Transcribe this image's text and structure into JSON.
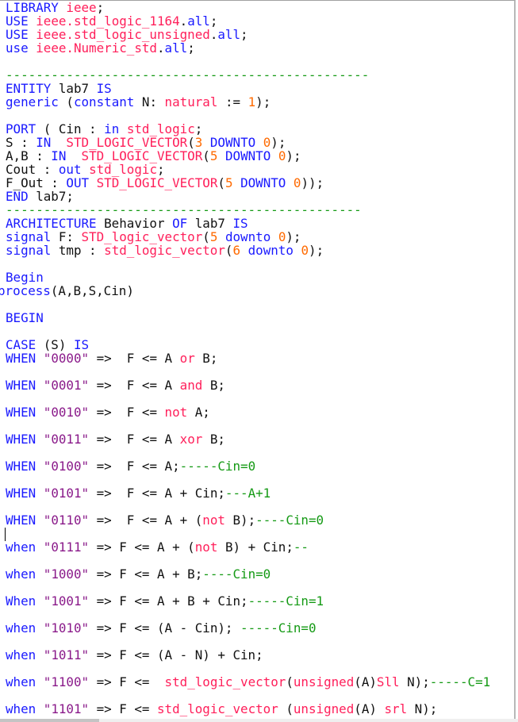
{
  "colors": {
    "keyword": "#1a1aff",
    "type": "#ff1f5a",
    "number": "#ff6a00",
    "string": "#8a1a8a",
    "comment": "#159a15",
    "text": "#111111"
  },
  "lines": [
    [
      [
        "k",
        "LIBRARY"
      ],
      [
        "p",
        " "
      ],
      [
        "t",
        "ieee"
      ],
      [
        "p",
        ";"
      ]
    ],
    [
      [
        "k",
        "USE"
      ],
      [
        "p",
        " "
      ],
      [
        "t",
        "ieee.std_logic_1164"
      ],
      [
        "p",
        "."
      ],
      [
        "k",
        "all"
      ],
      [
        "p",
        ";"
      ]
    ],
    [
      [
        "k",
        "USE"
      ],
      [
        "p",
        " "
      ],
      [
        "t",
        "ieee.std_logic_unsigned"
      ],
      [
        "p",
        "."
      ],
      [
        "k",
        "all"
      ],
      [
        "p",
        ";"
      ]
    ],
    [
      [
        "k",
        "use"
      ],
      [
        "p",
        " "
      ],
      [
        "t",
        "ieee.Numeric_std"
      ],
      [
        "p",
        "."
      ],
      [
        "k",
        "all"
      ],
      [
        "p",
        ";"
      ]
    ],
    [],
    [
      [
        "c",
        "------------------------------------------------"
      ]
    ],
    [
      [
        "k",
        "ENTITY"
      ],
      [
        "p",
        " lab7 "
      ],
      [
        "k",
        "IS"
      ]
    ],
    [
      [
        "k",
        "generic"
      ],
      [
        "p",
        " ("
      ],
      [
        "k",
        "constant"
      ],
      [
        "p",
        " N: "
      ],
      [
        "t",
        "natural"
      ],
      [
        "p",
        " := "
      ],
      [
        "n",
        "1"
      ],
      [
        "p",
        ");"
      ]
    ],
    [],
    [
      [
        "k",
        "PORT"
      ],
      [
        "p",
        " ( Cin : "
      ],
      [
        "k",
        "in"
      ],
      [
        "p",
        " "
      ],
      [
        "t",
        "std_logic"
      ],
      [
        "p",
        ";"
      ]
    ],
    [
      [
        "p",
        "S : "
      ],
      [
        "k",
        "IN"
      ],
      [
        "p",
        "  "
      ],
      [
        "t",
        "STD_LOGIC_VECTOR"
      ],
      [
        "p",
        "("
      ],
      [
        "n",
        "3"
      ],
      [
        "p",
        " "
      ],
      [
        "k",
        "DOWNTO"
      ],
      [
        "p",
        " "
      ],
      [
        "n",
        "0"
      ],
      [
        "p",
        ");"
      ]
    ],
    [
      [
        "p",
        "A,B : "
      ],
      [
        "k",
        "IN"
      ],
      [
        "p",
        "  "
      ],
      [
        "t",
        "STD_LOGIC_VECTOR"
      ],
      [
        "p",
        "("
      ],
      [
        "n",
        "5"
      ],
      [
        "p",
        " "
      ],
      [
        "k",
        "DOWNTO"
      ],
      [
        "p",
        " "
      ],
      [
        "n",
        "0"
      ],
      [
        "p",
        ");"
      ]
    ],
    [
      [
        "p",
        "Cout : "
      ],
      [
        "k",
        "out"
      ],
      [
        "p",
        " "
      ],
      [
        "t",
        "std_logic"
      ],
      [
        "p",
        ";"
      ]
    ],
    [
      [
        "p",
        "F_Out : "
      ],
      [
        "k",
        "OUT"
      ],
      [
        "p",
        " "
      ],
      [
        "t",
        "STD_LOGIC_VECTOR"
      ],
      [
        "p",
        "("
      ],
      [
        "n",
        "5"
      ],
      [
        "p",
        " "
      ],
      [
        "k",
        "DOWNTO"
      ],
      [
        "p",
        " "
      ],
      [
        "n",
        "0"
      ],
      [
        "p",
        "));"
      ]
    ],
    [
      [
        "k",
        "END"
      ],
      [
        "p",
        " lab7;"
      ]
    ],
    [
      [
        "c",
        "-----------------------------------------------"
      ]
    ],
    [
      [
        "k",
        "ARCHITECTURE"
      ],
      [
        "p",
        " Behavior "
      ],
      [
        "k",
        "OF"
      ],
      [
        "p",
        " lab7 "
      ],
      [
        "k",
        "IS"
      ]
    ],
    [
      [
        "k",
        "signal"
      ],
      [
        "p",
        " F: "
      ],
      [
        "t",
        "STD_logic_vector"
      ],
      [
        "p",
        "("
      ],
      [
        "n",
        "5"
      ],
      [
        "p",
        " "
      ],
      [
        "k",
        "downto"
      ],
      [
        "p",
        " "
      ],
      [
        "n",
        "0"
      ],
      [
        "p",
        ");"
      ]
    ],
    [
      [
        "k",
        "signal"
      ],
      [
        "p",
        " tmp : "
      ],
      [
        "t",
        "std_logic_vector"
      ],
      [
        "p",
        "("
      ],
      [
        "n",
        "6"
      ],
      [
        "p",
        " "
      ],
      [
        "k",
        "downto"
      ],
      [
        "p",
        " "
      ],
      [
        "n",
        "0"
      ],
      [
        "p",
        ");"
      ]
    ],
    [],
    [
      [
        "k",
        "Begin"
      ]
    ],
    [
      [
        "k",
        "process"
      ],
      [
        "p",
        "(A,B,S,Cin)"
      ]
    ],
    [],
    [
      [
        "k",
        "BEGIN"
      ]
    ],
    [],
    [
      [
        "k",
        "CASE"
      ],
      [
        "p",
        " (S) "
      ],
      [
        "k",
        "IS"
      ]
    ],
    [
      [
        "k",
        "WHEN"
      ],
      [
        "p",
        " "
      ],
      [
        "s",
        "\"0000\""
      ],
      [
        "p",
        " =>  F <= A "
      ],
      [
        "t",
        "or"
      ],
      [
        "p",
        " B;"
      ]
    ],
    [],
    [
      [
        "k",
        "WHEN"
      ],
      [
        "p",
        " "
      ],
      [
        "s",
        "\"0001\""
      ],
      [
        "p",
        " =>  F <= A "
      ],
      [
        "t",
        "and"
      ],
      [
        "p",
        " B;"
      ]
    ],
    [],
    [
      [
        "k",
        "WHEN"
      ],
      [
        "p",
        " "
      ],
      [
        "s",
        "\"0010\""
      ],
      [
        "p",
        " =>  F <= "
      ],
      [
        "t",
        "not"
      ],
      [
        "p",
        " A;"
      ]
    ],
    [],
    [
      [
        "k",
        "WHEN"
      ],
      [
        "p",
        " "
      ],
      [
        "s",
        "\"0011\""
      ],
      [
        "p",
        " =>  F <= A "
      ],
      [
        "t",
        "xor"
      ],
      [
        "p",
        " B;"
      ]
    ],
    [],
    [
      [
        "k",
        "WHEN"
      ],
      [
        "p",
        " "
      ],
      [
        "s",
        "\"0100\""
      ],
      [
        "p",
        " =>  F <= A;"
      ],
      [
        "c",
        "-----Cin=0"
      ]
    ],
    [],
    [
      [
        "k",
        "WHEN"
      ],
      [
        "p",
        " "
      ],
      [
        "s",
        "\"0101\""
      ],
      [
        "p",
        " =>  F <= A + Cin;"
      ],
      [
        "c",
        "---A+1"
      ]
    ],
    [],
    [
      [
        "k",
        "WHEN"
      ],
      [
        "p",
        " "
      ],
      [
        "s",
        "\"0110\""
      ],
      [
        "p",
        " =>  F <= A + ("
      ],
      [
        "t",
        "not"
      ],
      [
        "p",
        " B);"
      ],
      [
        "c",
        "----Cin=0"
      ]
    ],
    [],
    [
      [
        "k",
        "when"
      ],
      [
        "p",
        " "
      ],
      [
        "s",
        "\"0111\""
      ],
      [
        "p",
        " => F <= A + ("
      ],
      [
        "t",
        "not"
      ],
      [
        "p",
        " B) + Cin;"
      ],
      [
        "c",
        "--"
      ]
    ],
    [],
    [
      [
        "k",
        "when"
      ],
      [
        "p",
        " "
      ],
      [
        "s",
        "\"1000\""
      ],
      [
        "p",
        " => F <= A + B;"
      ],
      [
        "c",
        "----Cin=0"
      ]
    ],
    [],
    [
      [
        "k",
        "When"
      ],
      [
        "p",
        " "
      ],
      [
        "s",
        "\"1001\""
      ],
      [
        "p",
        " => F <= A + B + Cin;"
      ],
      [
        "c",
        "-----Cin=1"
      ]
    ],
    [],
    [
      [
        "k",
        "when"
      ],
      [
        "p",
        " "
      ],
      [
        "s",
        "\"1010\""
      ],
      [
        "p",
        " => F <= (A - Cin); "
      ],
      [
        "c",
        "-----Cin=0"
      ]
    ],
    [],
    [
      [
        "k",
        "when"
      ],
      [
        "p",
        " "
      ],
      [
        "s",
        "\"1011\""
      ],
      [
        "p",
        " => F <= (A - N) + Cin;"
      ]
    ],
    [],
    [
      [
        "k",
        "when"
      ],
      [
        "p",
        " "
      ],
      [
        "s",
        "\"1100\""
      ],
      [
        "p",
        " => F <=  "
      ],
      [
        "t",
        "std_logic_vector"
      ],
      [
        "p",
        "("
      ],
      [
        "t",
        "unsigned"
      ],
      [
        "p",
        "(A)"
      ],
      [
        "t",
        "Sll"
      ],
      [
        "p",
        " N);"
      ],
      [
        "c",
        "-----C=1"
      ]
    ],
    [],
    [
      [
        "k",
        "when"
      ],
      [
        "p",
        " "
      ],
      [
        "s",
        "\"1101\""
      ],
      [
        "p",
        " => F <= "
      ],
      [
        "t",
        "std_logic_vector"
      ],
      [
        "p",
        " ("
      ],
      [
        "t",
        "unsigned"
      ],
      [
        "p",
        "(A) "
      ],
      [
        "t",
        "srl"
      ],
      [
        "p",
        " N);"
      ]
    ]
  ]
}
